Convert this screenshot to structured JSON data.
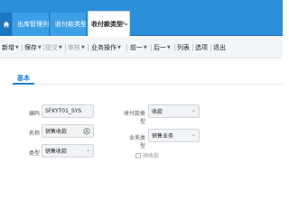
{
  "tabs": {
    "items": [
      {
        "label": "出库管理列表"
      },
      {
        "label": "收付款类型"
      },
      {
        "label": "收付款类型 - 修改"
      }
    ],
    "close": "×"
  },
  "toolbar": {
    "new": "新增",
    "save": "保存",
    "submit": "提交",
    "audit": "审核",
    "business_ops": "业务操作",
    "prev": "前一",
    "next": "后一",
    "list": "列表",
    "options": "选项",
    "exit": "退出"
  },
  "section": {
    "tab_basic": "基本"
  },
  "form": {
    "code_label": "编码",
    "code_value": "SFKYT01_SYS",
    "name_label": "名称",
    "name_value": "销售收款",
    "type_label": "类型",
    "type_value": "销售收款",
    "pay_type_label": "收付款类型",
    "pay_type_value": "收款",
    "biz_type_label": "业务类型",
    "biz_type_value": "销售业务",
    "checkbox_label": "预收款"
  }
}
